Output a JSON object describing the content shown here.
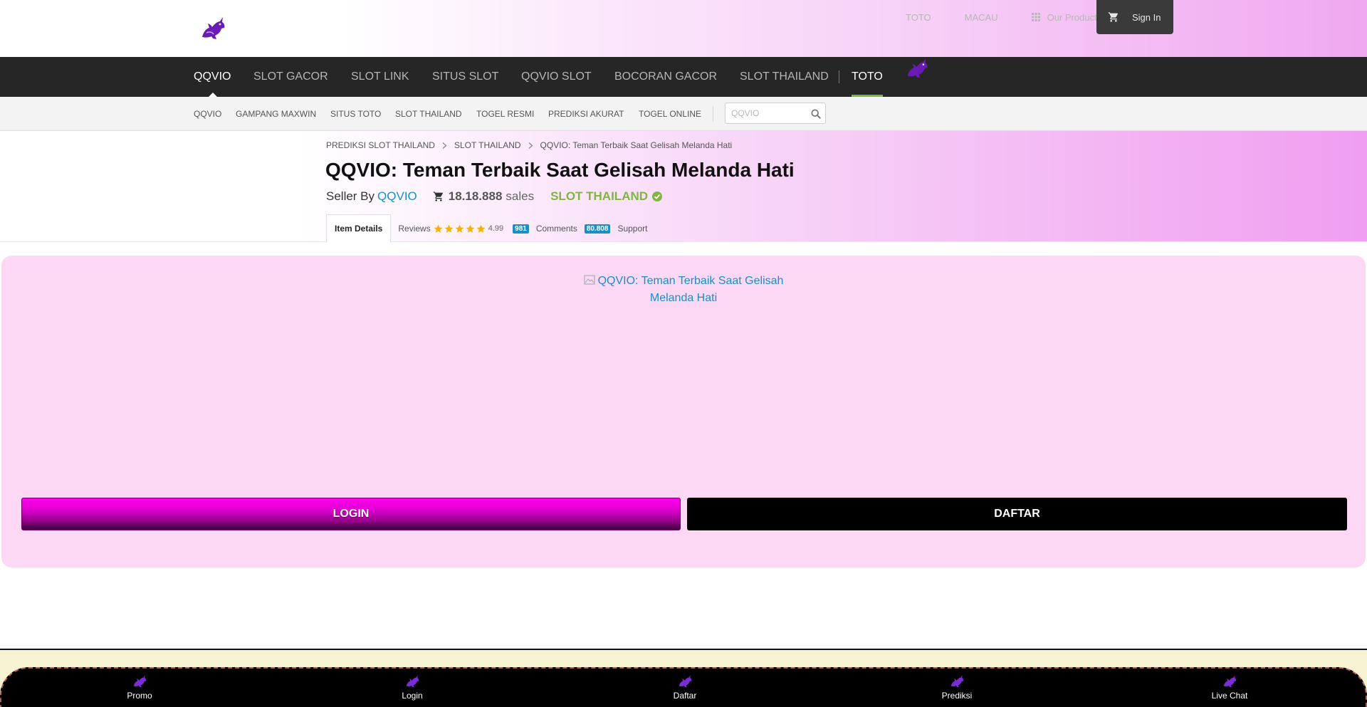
{
  "header": {
    "logo_alt": "QQVIO",
    "top_links": [
      "TOTO",
      "MACAU"
    ],
    "products_label": "Our Products",
    "signin_label": "Sign In"
  },
  "main_nav": {
    "items": [
      "QQVIO",
      "SLOT GACOR",
      "SLOT LINK",
      "SITUS SLOT",
      "QQVIO SLOT",
      "BOCORAN GACOR",
      "SLOT THAILAND",
      "TOTO"
    ],
    "active": "QQVIO",
    "highlighted": "TOTO"
  },
  "sub_nav": {
    "items": [
      "QQVIO",
      "GAMPANG MAXWIN",
      "SITUS TOTO",
      "SLOT THAILAND",
      "TOGEL RESMI",
      "PREDIKSI AKURAT",
      "TOGEL ONLINE"
    ],
    "search_placeholder": "QQVIO"
  },
  "breadcrumb": [
    "PREDIKSI SLOT THAILAND",
    "SLOT THAILAND",
    "QQVIO: Teman Terbaik Saat Gelisah Melanda Hati"
  ],
  "item": {
    "title": "QQVIO: Teman Terbaik Saat Gelisah Melanda Hati",
    "seller_prefix": "Seller By",
    "seller_name": "QQVIO",
    "sales_count": "18.18.888",
    "sales_unit": "sales",
    "category_badge": "SLOT THAILAND"
  },
  "tabs": {
    "item_details": "Item Details",
    "reviews_label": "Reviews",
    "rating": "4.99",
    "reviews_count": "981",
    "comments_label": "Comments",
    "comments_count": "80.808",
    "support_label": "Support"
  },
  "promo": {
    "image_alt": "QQVIO: Teman Terbaik Saat Gelisah Melanda Hati",
    "login_label": "LOGIN",
    "daftar_label": "DAFTAR"
  },
  "bottom_bar": {
    "items": [
      "Promo",
      "Login",
      "Daftar",
      "Prediksi",
      "Live Chat"
    ]
  },
  "colors": {
    "nav_bg": "#262626",
    "accent_green": "#82b440",
    "link_blue": "#1a8fc3",
    "promo_bg": "#fcd8f4",
    "login_magenta": "#e000d2",
    "logo_purple": "#6a1bb5"
  }
}
